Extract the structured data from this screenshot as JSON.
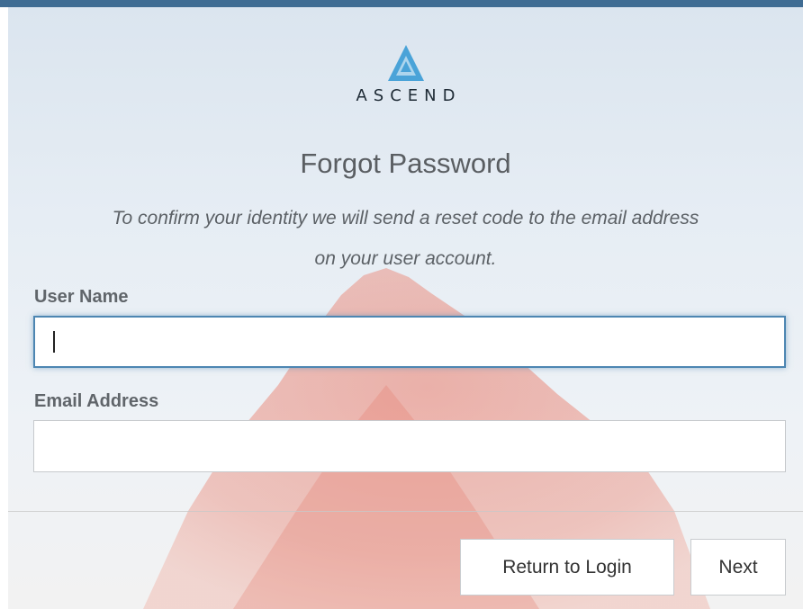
{
  "brand": {
    "logo_text": "ASCEND",
    "logo_color": "#4aa3d8",
    "accent_bar_color": "#3f6c93"
  },
  "form": {
    "title": "Forgot Password",
    "subtitle_line1": "To confirm your identity we will send a reset code to the email address",
    "subtitle_line2": "on your user account.",
    "username": {
      "label": "User Name",
      "value": "",
      "placeholder": ""
    },
    "email": {
      "label": "Email Address",
      "value": "",
      "placeholder": ""
    }
  },
  "actions": {
    "return_label": "Return to Login",
    "next_label": "Next"
  }
}
